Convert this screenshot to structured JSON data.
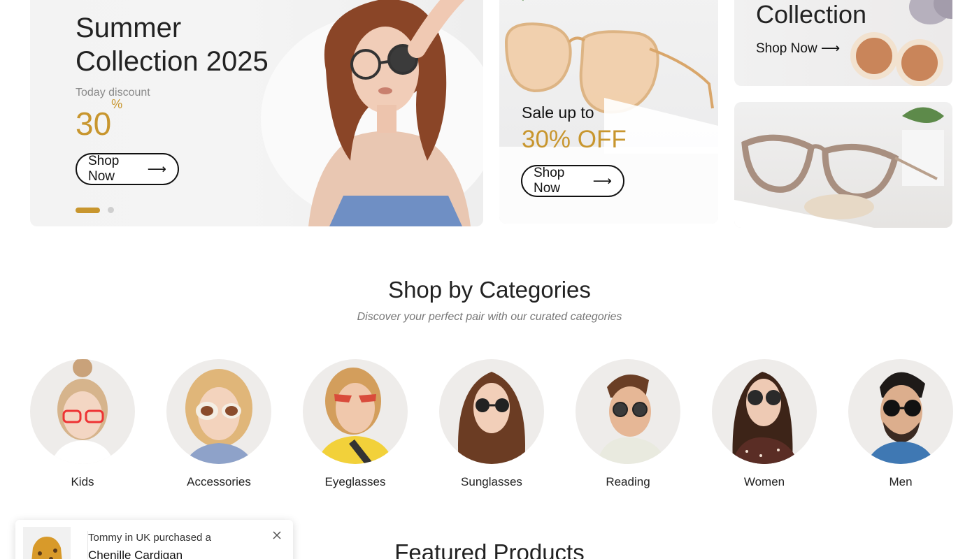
{
  "hero": {
    "title_line1": "Summer",
    "title_line2": "Collection 2025",
    "subtitle": "Today discount",
    "discount_value": "30",
    "discount_unit": "%",
    "button_label": "Shop Now",
    "slides": 2,
    "active_slide": 1
  },
  "promo": {
    "title": "Sale up to",
    "offer": "30% OFF",
    "button_label": "Shop Now"
  },
  "side_banner": {
    "title": "Collection",
    "link_label": "Shop Now"
  },
  "categories": {
    "title": "Shop by Categories",
    "subtitle": "Discover your perfect pair with our curated categories",
    "items": [
      {
        "label": "Kids",
        "icon": "kid-portrait-icon"
      },
      {
        "label": "Accessories",
        "icon": "accessories-portrait-icon"
      },
      {
        "label": "Eyeglasses",
        "icon": "eyeglasses-portrait-icon"
      },
      {
        "label": "Sunglasses",
        "icon": "sunglasses-portrait-icon"
      },
      {
        "label": "Reading",
        "icon": "reading-portrait-icon"
      },
      {
        "label": "Women",
        "icon": "women-portrait-icon"
      },
      {
        "label": "Men",
        "icon": "men-portrait-icon"
      }
    ]
  },
  "featured": {
    "title": "Featured Products"
  },
  "toast": {
    "line1": "Tommy in UK purchased a",
    "line2": "Chenille Cardigan",
    "close_icon": "close-icon"
  },
  "colors": {
    "accent": "#c8962e",
    "text": "#222222",
    "muted": "#8a8a8a"
  }
}
